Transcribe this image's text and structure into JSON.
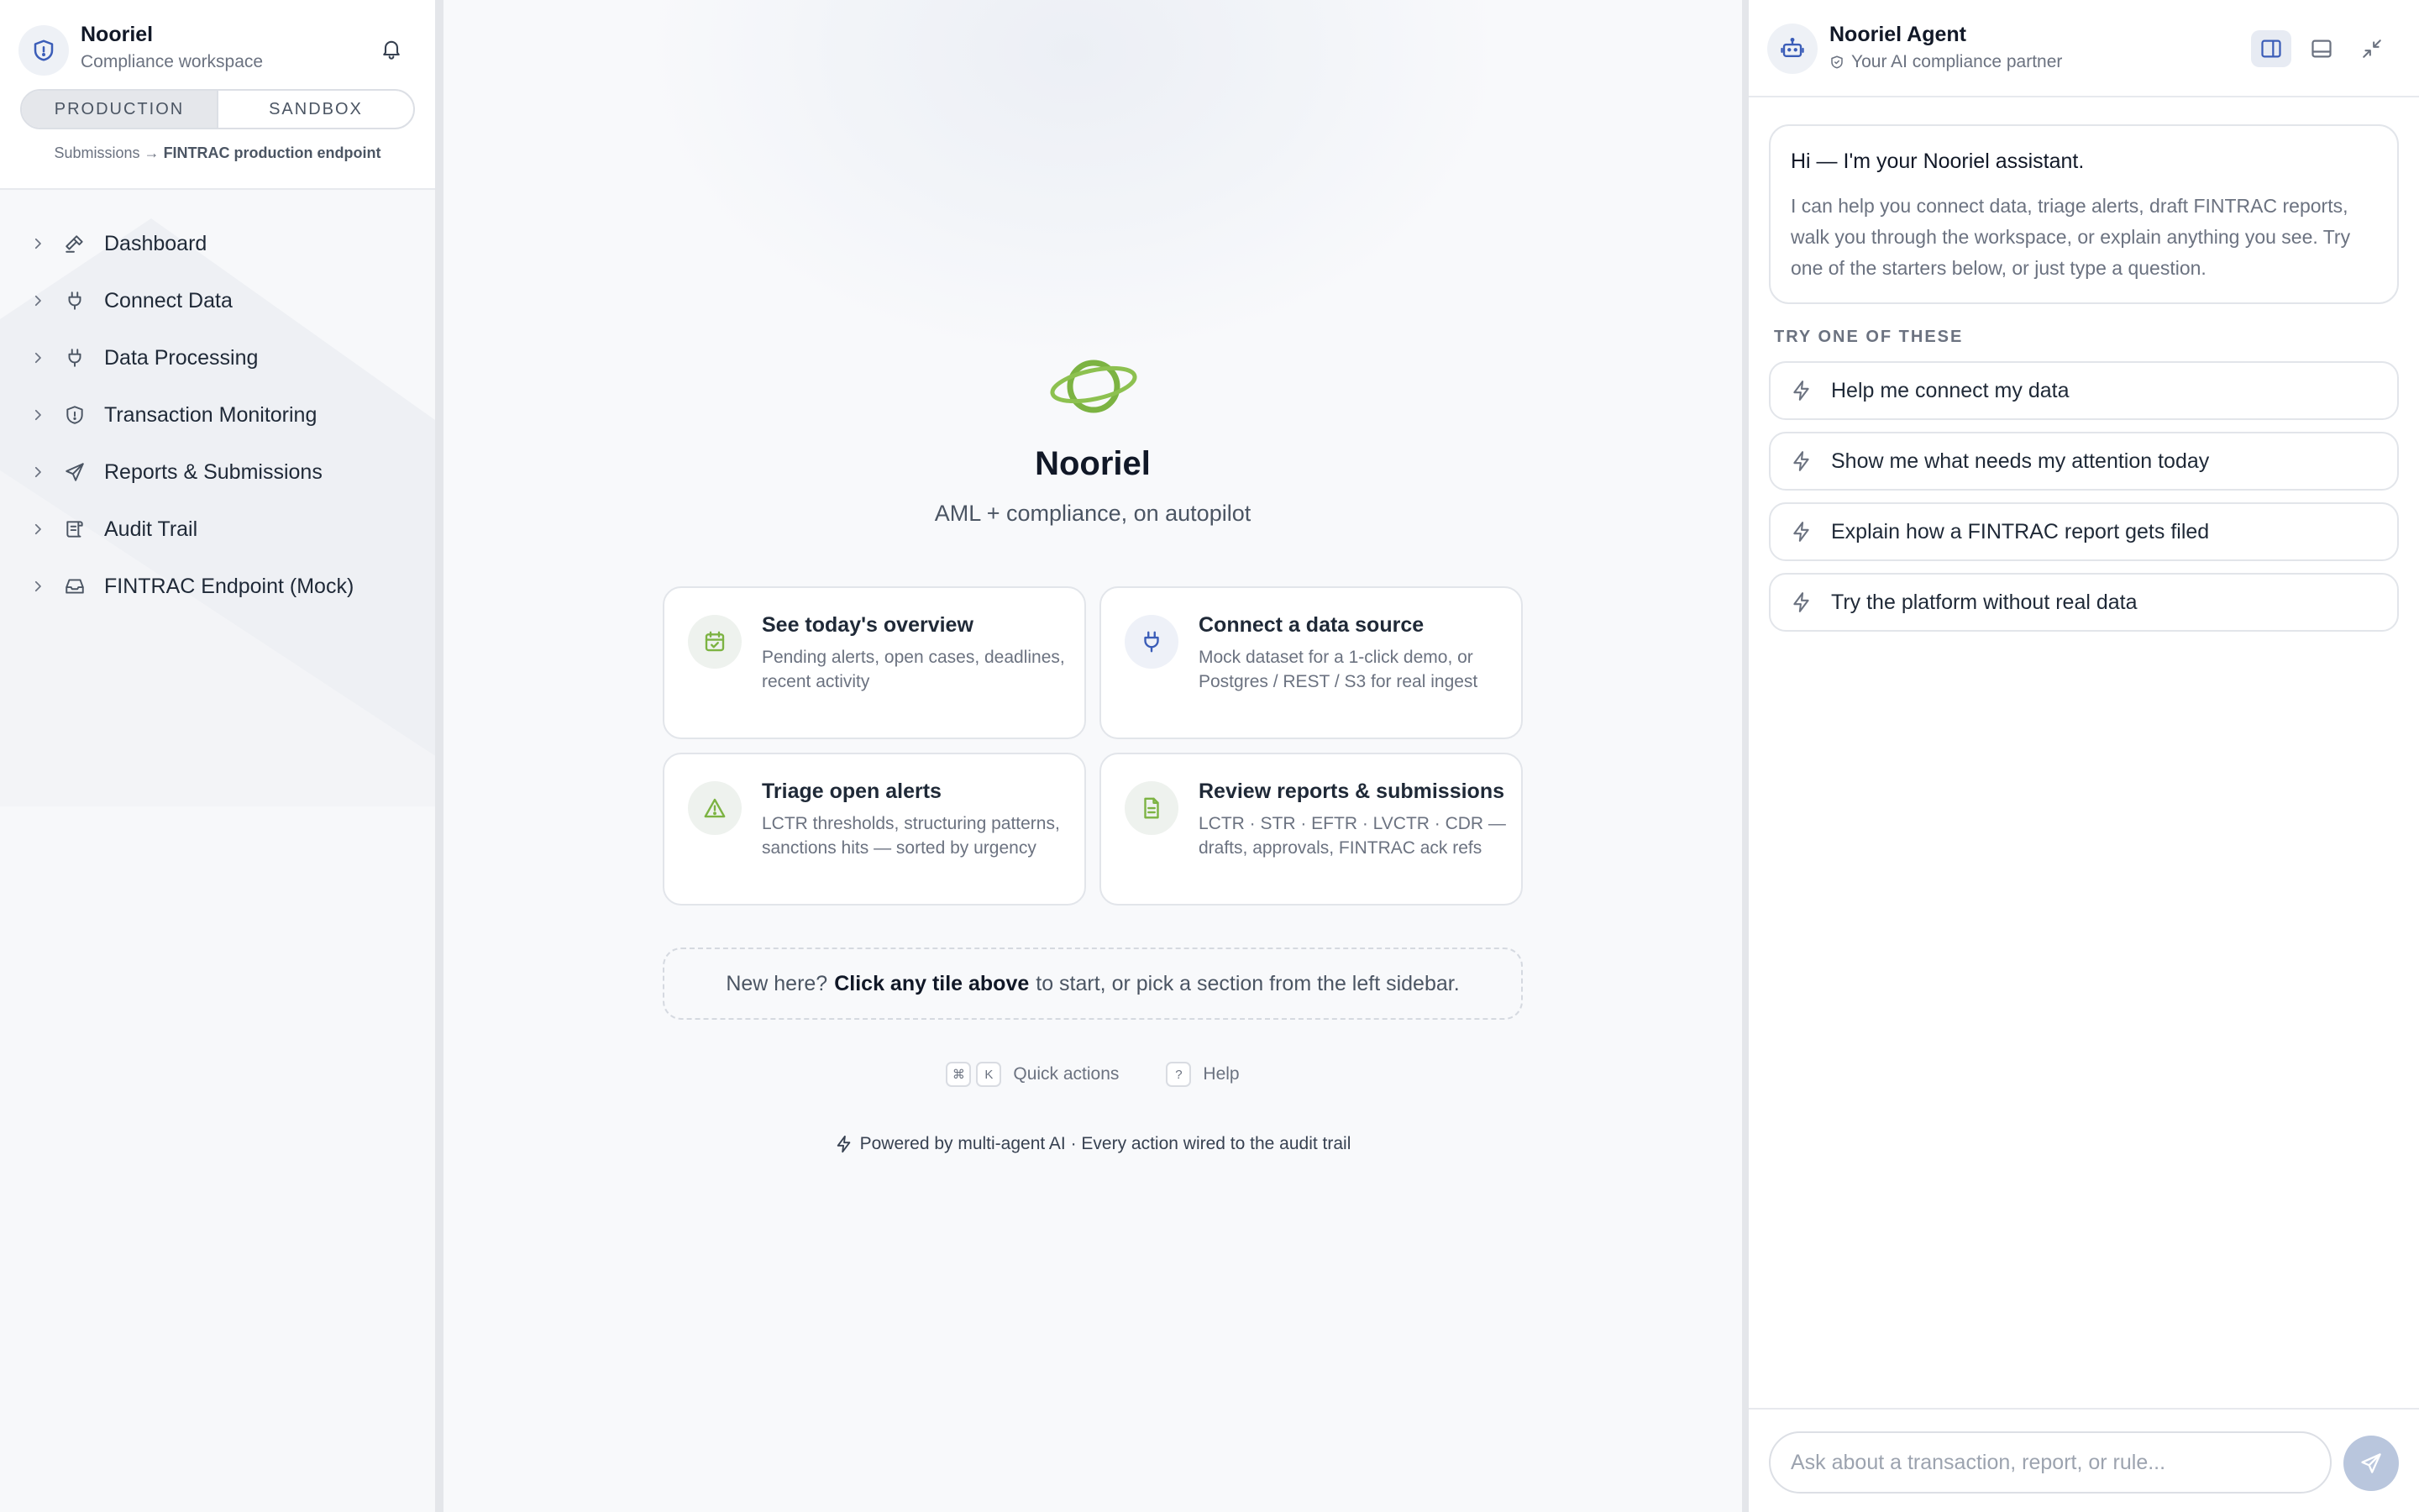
{
  "sidebar": {
    "brand": {
      "title": "Nooriel",
      "subtitle": "Compliance workspace"
    },
    "env_tabs": [
      "PRODUCTION",
      "SANDBOX"
    ],
    "active_env": "PRODUCTION",
    "breadcrumb": {
      "from": "Submissions",
      "arrow": "→",
      "to": "FINTRAC production endpoint"
    },
    "nav": [
      {
        "label": "Dashboard",
        "icon": "hammer-icon"
      },
      {
        "label": "Connect Data",
        "icon": "plug-icon"
      },
      {
        "label": "Data Processing",
        "icon": "plug-icon"
      },
      {
        "label": "Transaction Monitoring",
        "icon": "shield-icon"
      },
      {
        "label": "Reports & Submissions",
        "icon": "send-icon"
      },
      {
        "label": "Audit Trail",
        "icon": "scroll-icon"
      },
      {
        "label": "FINTRAC Endpoint (Mock)",
        "icon": "inbox-icon"
      }
    ]
  },
  "main": {
    "title": "Nooriel",
    "subtitle": "AML + compliance, on autopilot",
    "tiles": [
      {
        "title": "See today's overview",
        "description": "Pending alerts, open cases, deadlines, recent activity",
        "icon": "calendar-check-icon"
      },
      {
        "title": "Connect a data source",
        "description": "Mock dataset for a 1-click demo, or Postgres / REST / S3 for real ingest",
        "icon": "plug-icon"
      },
      {
        "title": "Triage open alerts",
        "description": "LCTR thresholds, structuring patterns, sanctions hits — sorted by urgency",
        "icon": "warning-icon"
      },
      {
        "title": "Review reports & submissions",
        "description": "LCTR · STR · EFTR · LVCTR · CDR — drafts, approvals, FINTRAC ack refs",
        "icon": "document-icon"
      }
    ],
    "hint": {
      "prefix": "New here?",
      "bold": "Click any tile above",
      "suffix": "to start, or pick a section from the left sidebar."
    },
    "shortcuts": {
      "cmd_key": "⌘",
      "k_key": "K",
      "quick_label": "Quick actions",
      "help_key": "?",
      "help_label": "Help"
    },
    "powered_by": "Powered by multi-agent AI · Every action wired to the audit trail"
  },
  "agent": {
    "title": "Nooriel Agent",
    "subtitle": "Your AI compliance partner",
    "greeting_title": "Hi — I'm your Nooriel assistant.",
    "greeting_body": "I can help you connect data, triage alerts, draft FINTRAC reports, walk you through the workspace, or explain anything you see. Try one of the starters below, or just type a question.",
    "starters_label": "TRY ONE OF THESE",
    "starters": [
      "Help me connect my data",
      "Show me what needs my attention today",
      "Explain how a FINTRAC report gets filed",
      "Try the platform without real data"
    ],
    "input_placeholder": "Ask about a transaction, report, or rule..."
  },
  "colors": {
    "accent_green": "#7cb342",
    "accent_blue": "#3b5db8",
    "send_button": "#b9c6dd"
  }
}
